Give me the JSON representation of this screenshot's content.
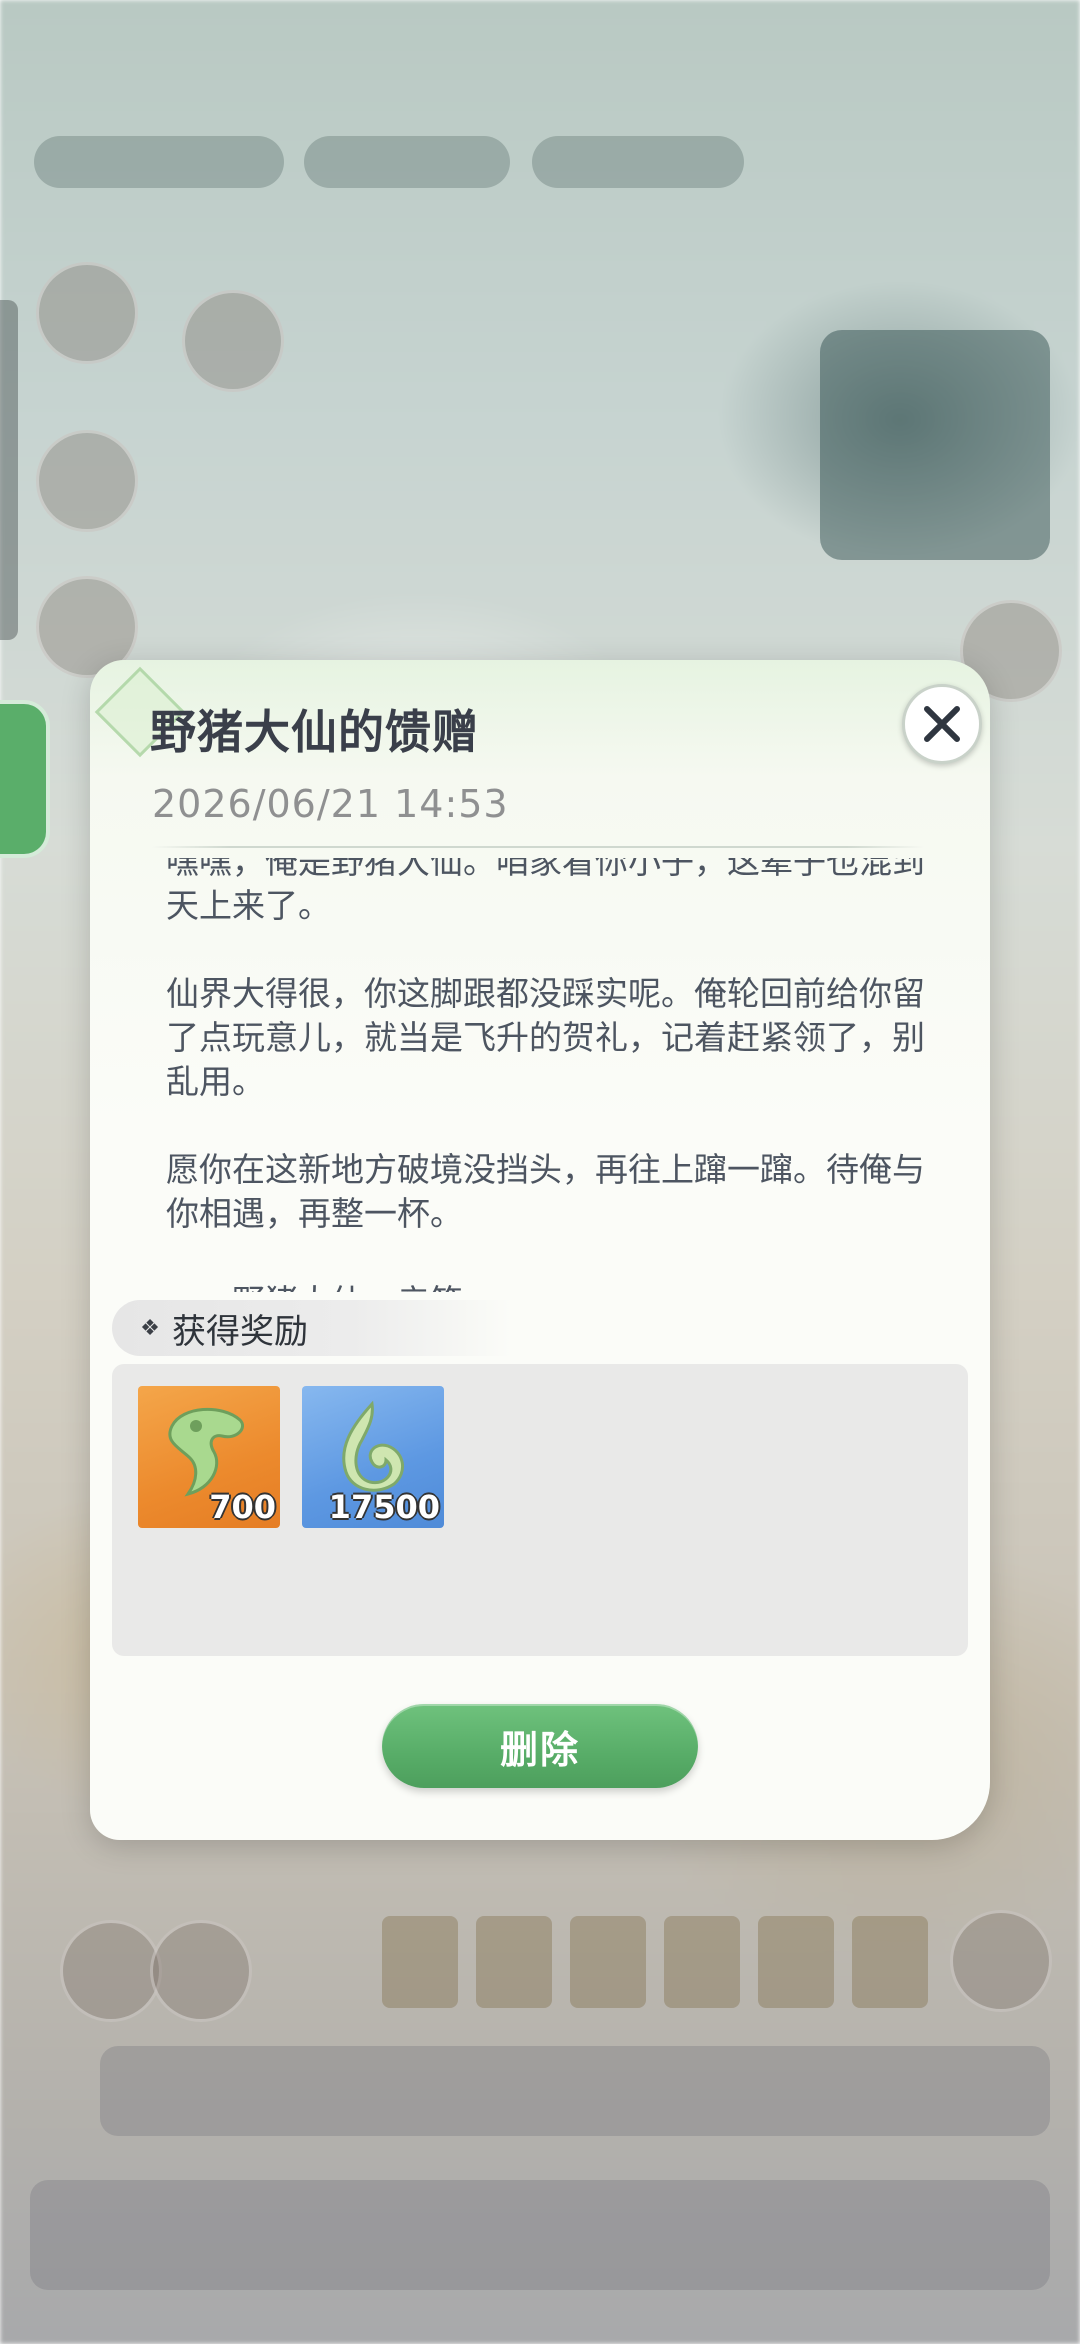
{
  "dialog": {
    "title": "野猪大仙的馈赠",
    "date": "2026/06/21 14:53",
    "letter_paragraphs": [
      "嘿嘿，俺是野猪大仙。咱家看你小子，这辈子也混到天上来了。",
      "仙界大得很，你这脚跟都没踩实呢。俺轮回前给你留了点玩意儿，就当是飞升的贺礼，记着赶紧领了，别乱用。",
      "愿你在这新地方破境没挡头，再往上蹿一蹿。待俺与你相遇，再整一杯。",
      "——野猪大仙，亲笔"
    ],
    "reward_header": "获得奖励",
    "rewards": [
      {
        "icon": "jade-pendant-icon",
        "count": "700",
        "bg_color": "#ec8a2d"
      },
      {
        "icon": "spirit-jade-icon",
        "count": "17500",
        "bg_color": "#5d98e2"
      }
    ],
    "delete_label": "删除",
    "accent_color": "#58ad68"
  }
}
